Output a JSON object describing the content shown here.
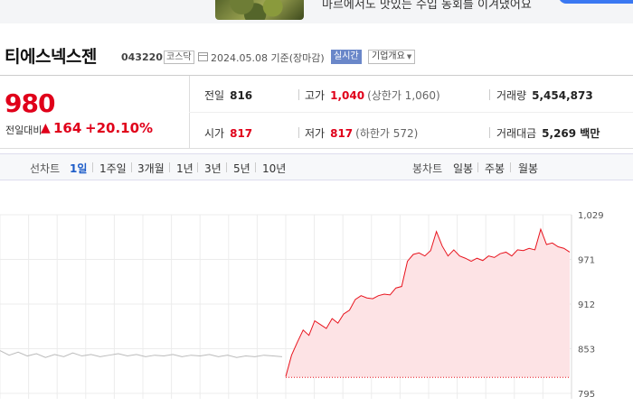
{
  "banner": {
    "text": "마르에서도 맛있는 수입 농회를 이겨냈어요"
  },
  "stock": {
    "name": "티에스넥스젠",
    "code": "043220",
    "market": "코스닥",
    "date": "2024.05.08 기준(장마감)",
    "live_badge": "실시간",
    "overview_label": "기업개요"
  },
  "quote": {
    "price": "980",
    "change_label": "전일대비",
    "change_arrow": "▲",
    "change": "164",
    "change_pct": "+20.10%"
  },
  "stats": {
    "prev_label": "전일",
    "prev": "816",
    "high_label": "고가",
    "high": "1,040",
    "high_sub": "(상한가 1,060)",
    "volume_label": "거래량",
    "volume": "5,454,873",
    "open_label": "시가",
    "open": "817",
    "low_label": "저가",
    "low": "817",
    "low_sub": "(하한가 572)",
    "amount_label": "거래대금",
    "amount": "5,269 백만"
  },
  "toolbar": {
    "line_label": "선차트",
    "periods": [
      "1일",
      "1주일",
      "3개월",
      "1년",
      "3년",
      "5년",
      "10년"
    ],
    "candle_label": "봉차트",
    "candles": [
      "일봉",
      "주봉",
      "월봉"
    ]
  },
  "colors": {
    "up": "#e0001a",
    "selected": "#1d5cc8",
    "fill": "#fde3e5",
    "line": "#e8141e",
    "prev_line": "#bbbbbb"
  },
  "chart_data": {
    "type": "area",
    "ylim": [
      795,
      1029
    ],
    "y_ticks": [
      "1,029",
      "971",
      "912",
      "853",
      "795"
    ],
    "prev_close": 816,
    "prev_session": [
      851,
      845,
      849,
      844,
      847,
      842,
      846,
      843,
      848,
      844,
      846,
      843,
      845,
      847,
      844,
      846,
      843,
      845,
      844,
      846,
      843,
      845,
      844,
      846,
      843,
      845,
      842,
      844,
      843,
      845,
      844,
      843
    ],
    "today": [
      817,
      845,
      862,
      878,
      871,
      890,
      885,
      880,
      893,
      887,
      899,
      904,
      918,
      923,
      920,
      919,
      923,
      925,
      924,
      933,
      935,
      968,
      977,
      979,
      975,
      982,
      1007,
      988,
      975,
      983,
      975,
      972,
      968,
      972,
      969,
      975,
      973,
      978,
      980,
      975,
      983,
      982,
      985,
      983,
      1010,
      990,
      992,
      987,
      985,
      980
    ]
  }
}
